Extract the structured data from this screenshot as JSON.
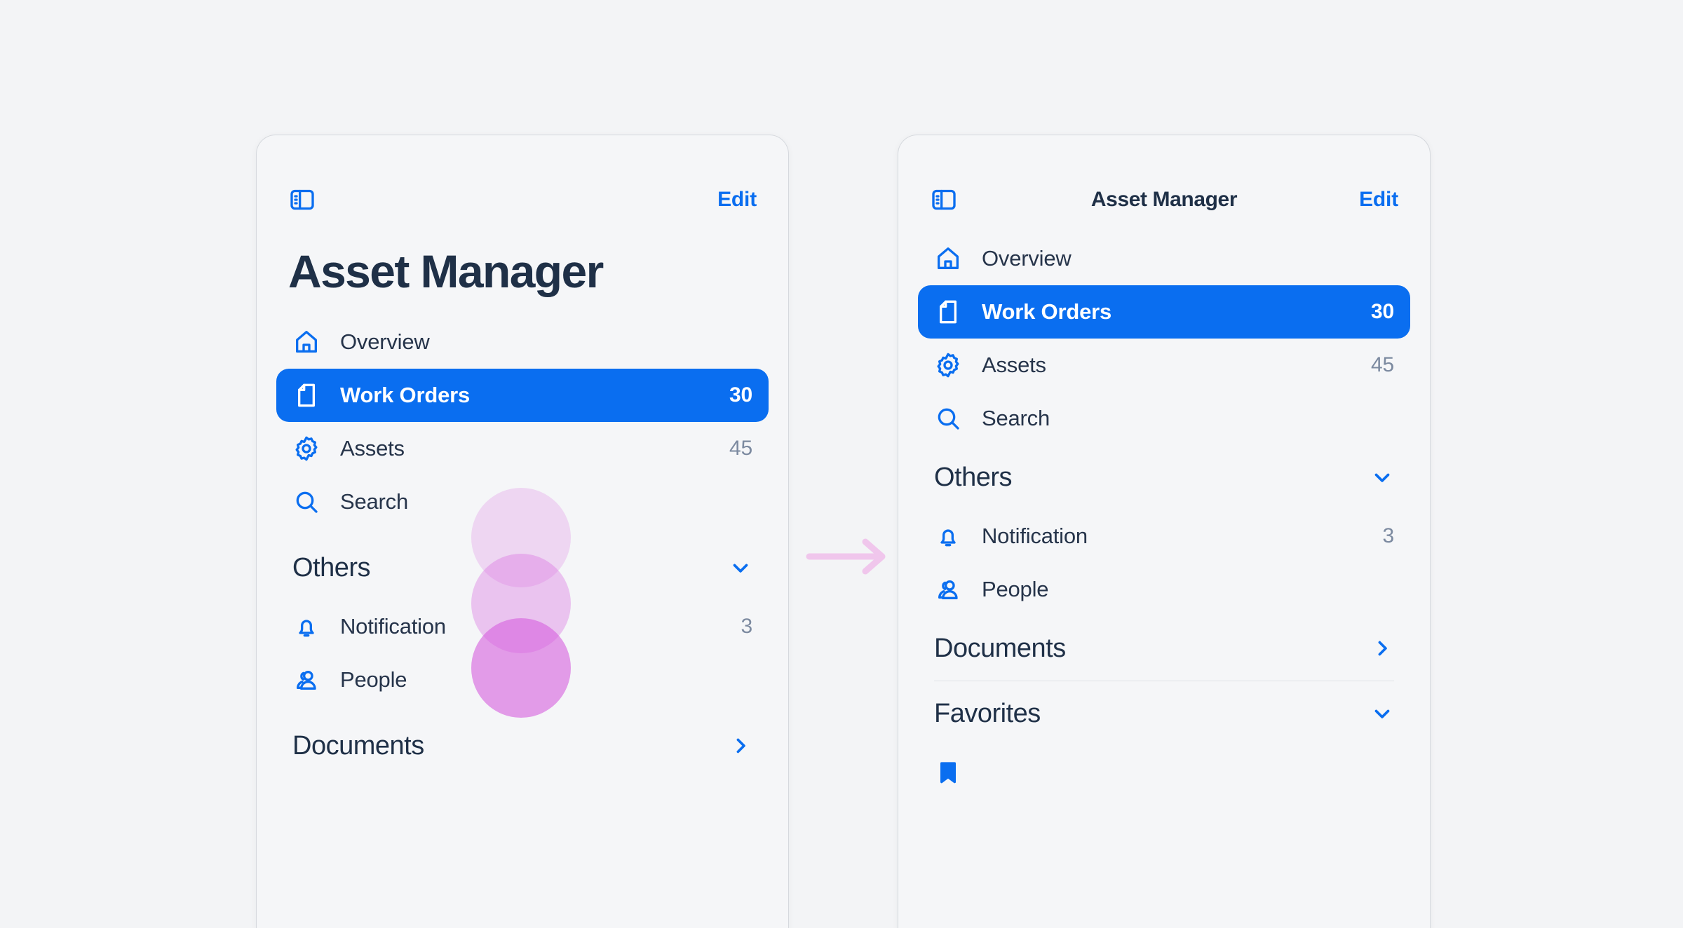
{
  "theme": {
    "page_background": "#f3f4f6",
    "panel_background": "#f5f6f8",
    "accent_blue": "#0a6ef0",
    "text_dark": "#1f3047",
    "text_muted": "#7c8aa0",
    "gesture_pink": "#d662de"
  },
  "left_panel": {
    "toggle_icon": "sidebar-toggle-icon",
    "edit_label": "Edit",
    "title": "Asset Manager",
    "items": [
      {
        "icon": "home-icon",
        "label": "Overview",
        "count": "",
        "active": false
      },
      {
        "icon": "document-icon",
        "label": "Work Orders",
        "count": "30",
        "active": true
      },
      {
        "icon": "gear-icon",
        "label": "Assets",
        "count": "45",
        "active": false
      },
      {
        "icon": "search-icon",
        "label": "Search",
        "count": "",
        "active": false
      }
    ],
    "sections": [
      {
        "title": "Others",
        "chevron": "chevron-down-icon"
      },
      {
        "title": "Documents",
        "chevron": "chevron-right-icon"
      }
    ],
    "others_items": [
      {
        "icon": "bell-icon",
        "label": "Notification",
        "count": "3"
      },
      {
        "icon": "people-icon",
        "label": "People",
        "count": ""
      }
    ]
  },
  "right_panel": {
    "toggle_icon": "sidebar-toggle-icon",
    "title": "Asset Manager",
    "edit_label": "Edit",
    "items": [
      {
        "icon": "home-icon",
        "label": "Overview",
        "count": "",
        "active": false
      },
      {
        "icon": "document-icon",
        "label": "Work Orders",
        "count": "30",
        "active": true
      },
      {
        "icon": "gear-icon",
        "label": "Assets",
        "count": "45",
        "active": false
      },
      {
        "icon": "search-icon",
        "label": "Search",
        "count": "",
        "active": false
      }
    ],
    "sections": [
      {
        "title": "Others",
        "chevron": "chevron-down-icon"
      },
      {
        "title": "Documents",
        "chevron": "chevron-right-icon"
      },
      {
        "title": "Favorites",
        "chevron": "chevron-down-icon"
      }
    ],
    "others_items": [
      {
        "icon": "bell-icon",
        "label": "Notification",
        "count": "3"
      },
      {
        "icon": "people-icon",
        "label": "People",
        "count": ""
      }
    ]
  },
  "annotation": {
    "arrow_icon": "arrow-right-icon",
    "gesture_icon": "touch-trail-circles"
  }
}
